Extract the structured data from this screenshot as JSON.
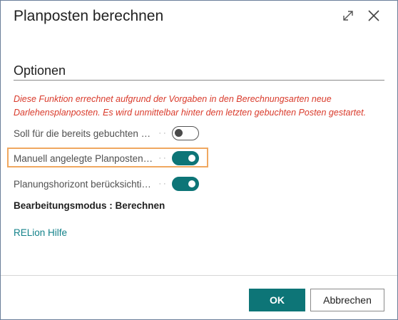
{
  "dialog": {
    "title": "Planposten berechnen",
    "icons": [
      "expand-icon",
      "close-icon"
    ]
  },
  "options": {
    "section_title": "Optionen",
    "info_text": "Diese Funktion errechnet aufgrund der Vorgaben in den Berechnungsarten neue Darlehensplanposten. Es wird unmittelbar hinter dem letzten gebuchten Posten gestartet.",
    "fields": [
      {
        "label": "Soll für die bereits gebuchten Zei...",
        "value": false
      },
      {
        "label": "Manuell angelegte Planposten  l...",
        "value": true
      },
      {
        "label": "Planungshorizont berücksichtigen",
        "value": true
      }
    ],
    "mode_text": "Bearbeitungsmodus : Berechnen",
    "help_link": "RELion Hilfe"
  },
  "footer": {
    "ok_label": "OK",
    "cancel_label": "Abbrechen"
  },
  "colors": {
    "accent": "#0d7577",
    "warning_text": "#d93a2b",
    "highlight_border": "#f0a860",
    "link": "#13828a"
  }
}
